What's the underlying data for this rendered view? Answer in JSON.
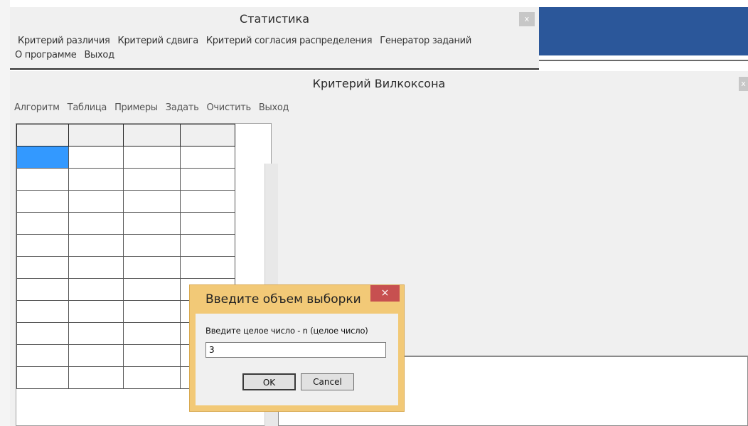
{
  "stat_window": {
    "title": "Статистика",
    "close_label": "x",
    "menu": [
      "Критерий различия",
      "Критерий сдвига",
      "Критерий согласия распределения",
      "Генератор заданий",
      "О программе",
      "Выход"
    ]
  },
  "wilcoxon_window": {
    "title": "Критерий Вилкоксона",
    "close_label": "x",
    "menu": [
      "Алгоритм",
      "Таблица",
      "Примеры",
      "Задать",
      "Очистить",
      "Выход"
    ]
  },
  "dialog": {
    "title": "Введите объем выборки",
    "close_label": "×",
    "prompt": "Введите целое число - n (целое число)",
    "input_value": "3",
    "ok_label": "OK",
    "cancel_label": "Cancel"
  },
  "colors": {
    "selected_cell": "#3399ff",
    "dialog_frame": "#f2c977",
    "dialog_close": "#c75050",
    "taskbar_blue": "#2b579a"
  }
}
